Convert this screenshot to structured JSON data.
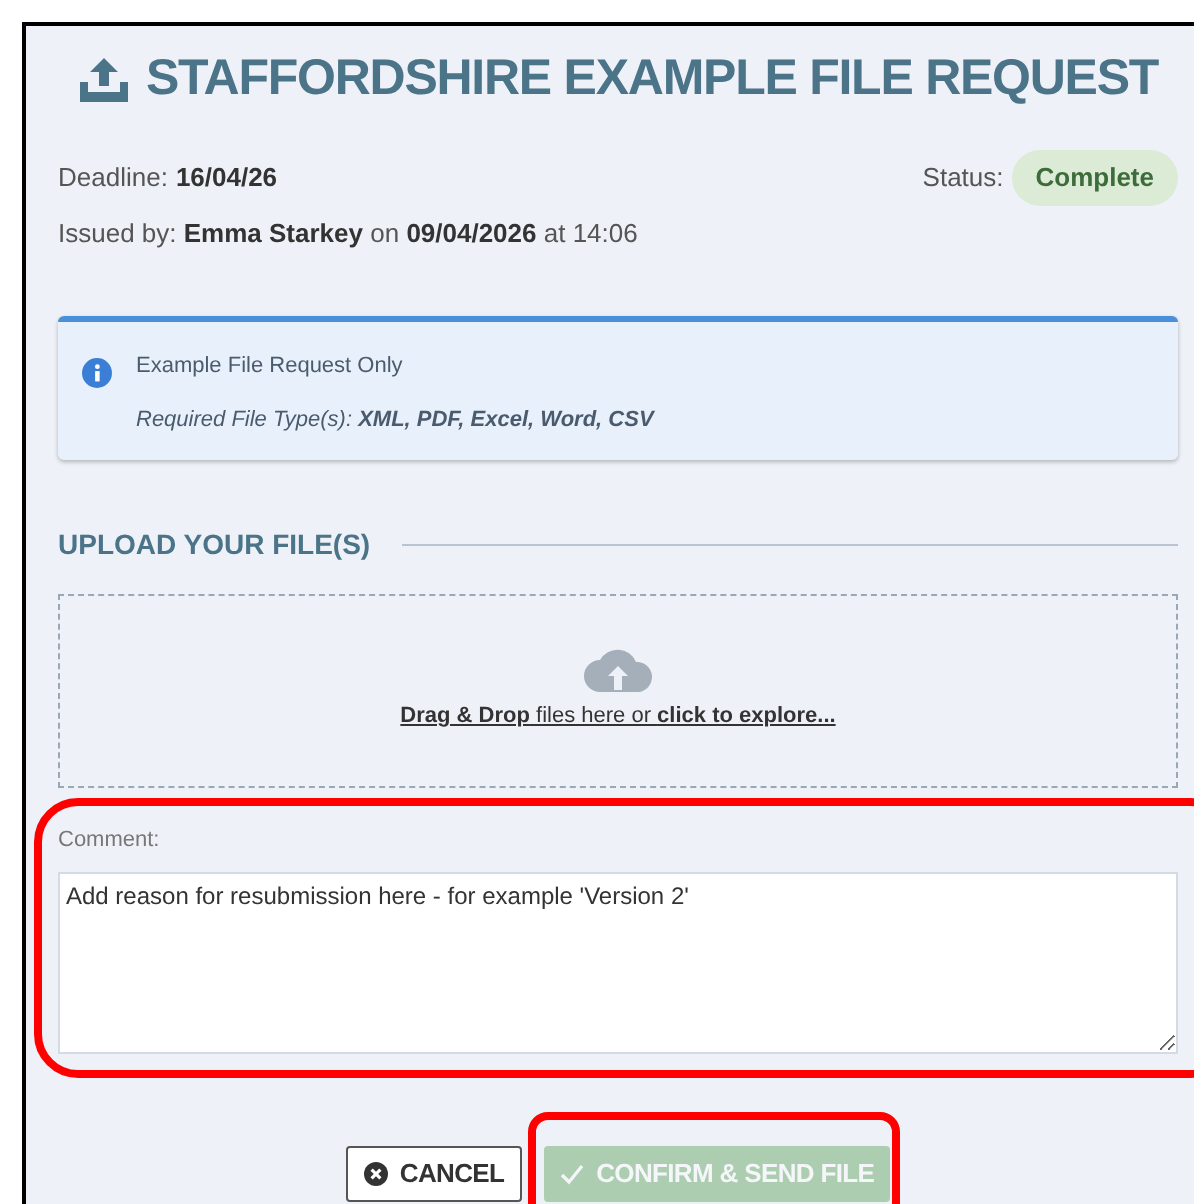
{
  "header": {
    "title": "STAFFORDSHIRE EXAMPLE FILE REQUEST"
  },
  "details": {
    "deadline_label": "Deadline:",
    "deadline": "16/04/26",
    "status_label": "Status:",
    "status": "Complete",
    "issued": "Issued by: **Emma Starkey** on **09/04/2026** at 14:06"
  },
  "info": {
    "title": "Example File Request Only",
    "file_types": "Required File Type(s): **XML, PDF, Excel, Word, CSV**"
  },
  "upload": {
    "heading": "UPLOAD YOUR FILE(S)",
    "drop_bold": "Drag & Drop",
    "drop_middle": " files here or ",
    "drop_link": "click to explore..."
  },
  "comment": {
    "label": "Comment:",
    "value": "Add reason for resubmission here - for example 'Version 2'",
    "highlighted": true
  },
  "buttons": [
    {
      "kind": "cancel",
      "label": "CANCEL",
      "disabled": false,
      "highlighted": false
    },
    {
      "kind": "confirm",
      "label": "CONFIRM & SEND FILE",
      "disabled": true,
      "highlighted": true
    }
  ]
}
